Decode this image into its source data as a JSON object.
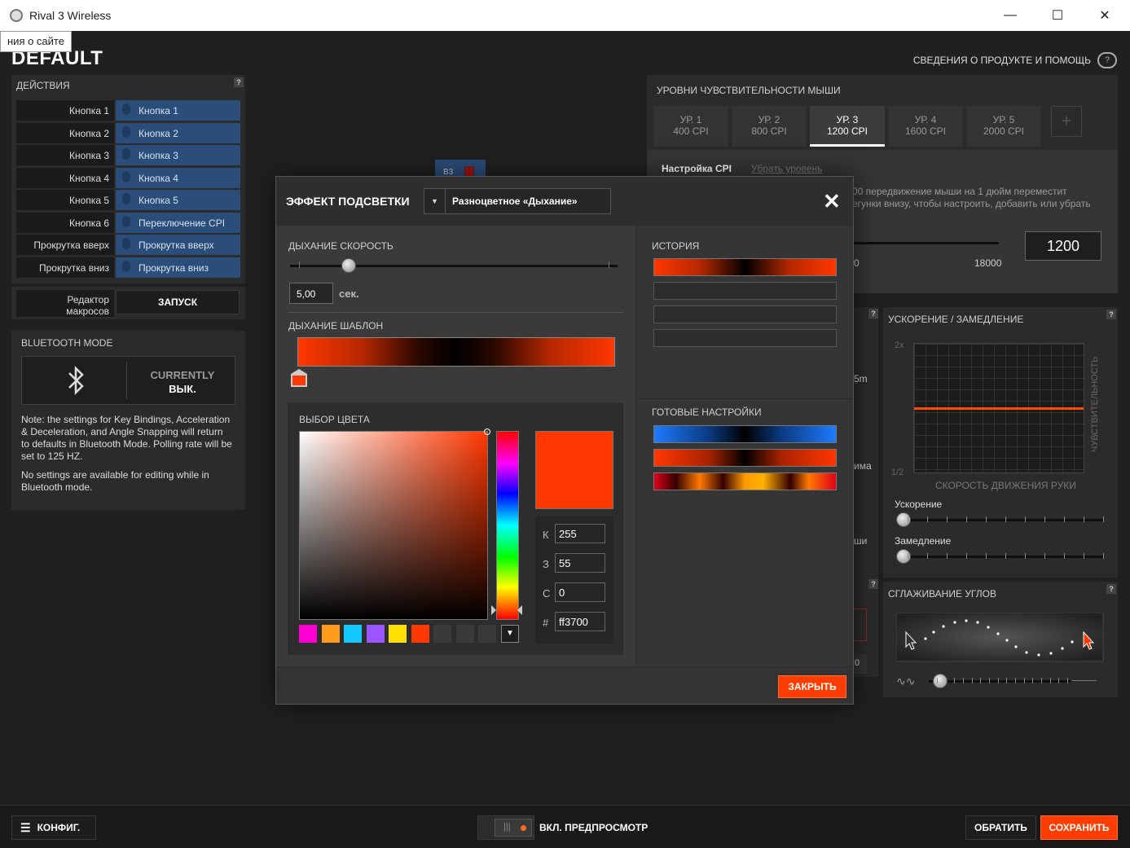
{
  "window": {
    "title": "Rival 3 Wireless",
    "minimize": "—",
    "maximize": "☐",
    "close": "✕"
  },
  "header": {
    "title": "DEFAULT",
    "tooltip": "ния о сайте",
    "help_link": "СВЕДЕНИЯ О ПРОДУКТЕ И ПОМОЩЬ",
    "help_icon": "?"
  },
  "actions": {
    "title": "ДЕЙСТВИЯ",
    "help": "?",
    "rows": [
      {
        "label": "Кнопка 1",
        "value": "Кнопка 1"
      },
      {
        "label": "Кнопка 2",
        "value": "Кнопка 2"
      },
      {
        "label": "Кнопка 3",
        "value": "Кнопка 3"
      },
      {
        "label": "Кнопка 4",
        "value": "Кнопка 4"
      },
      {
        "label": "Кнопка 5",
        "value": "Кнопка 5"
      },
      {
        "label": "Кнопка 6",
        "value": "Переключение CPI"
      },
      {
        "label": "Прокрутка вверх",
        "value": "Прокрутка вверх"
      },
      {
        "label": "Прокрутка вниз",
        "value": "Прокрутка вниз"
      }
    ]
  },
  "macro": {
    "label_line1": "Редактор",
    "label_line2": "макросов",
    "button": "ЗАПУСК"
  },
  "bluetooth": {
    "title": "BLUETOOTH MODE",
    "status_line1": "CURRENTLY",
    "status_line2": "ВЫК.",
    "note1": "Note: the settings for Key Bindings, Acceleration & Deceleration, and Angle Snapping will return to defaults in Bluetooth Mode. Polling rate will be set to 125 HZ.",
    "note2": "No settings are available for editing while in Bluetooth mode."
  },
  "cpi": {
    "title": "УРОВНИ ЧУВСТВИТЕЛЬНОСТИ МЫШИ",
    "tabs": [
      {
        "level": "УР. 1",
        "cpi": "400 CPI"
      },
      {
        "level": "УР. 2",
        "cpi": "800 CPI"
      },
      {
        "level": "УР. 3",
        "cpi": "1200 CPI"
      },
      {
        "level": "УР. 4",
        "cpi": "1600 CPI"
      },
      {
        "level": "УР. 5",
        "cpi": "2000 CPI"
      }
    ],
    "add": "+",
    "settings_tab": "Настройка CPI",
    "remove_level": "Убрать уровень",
    "desc_line1": "00 передвижение мыши на 1 дюйм переместит",
    "desc_line2": "егунки внизу, чтобы настроить, добавить или убрать",
    "min_label": "0",
    "max_label": "18000",
    "value": "1200"
  },
  "partial": {
    "b3": "B3",
    "m": "5m",
    "ma": "има",
    "shi": "ши",
    "zero": "0",
    "help": "?"
  },
  "acceleration": {
    "title": "УСКОРЕНИЕ / ЗАМЕДЛЕНИЕ",
    "help": "?",
    "y_top": "2x",
    "y_bottom": "1/2",
    "x_label": "СКОРОСТЬ ДВИЖЕНИЯ РУКИ",
    "y_label": "ЧУВСТВИТЕЛЬНОСТЬ",
    "accel_label": "Ускорение",
    "decel_label": "Замедление",
    "accel_value": 0,
    "decel_value": 0
  },
  "angle": {
    "title": "СГЛАЖИВАНИЕ УГЛОВ",
    "help": "?",
    "value": 0.08
  },
  "bottom": {
    "config": "КОНФИГ.",
    "preview": "ВКЛ. ПРЕДПРОСМОТР",
    "revert": "ОБРАТИТЬ",
    "save": "СОХРАНИТЬ"
  },
  "modal": {
    "title": "ЭФФЕКТ ПОДСВЕТКИ",
    "effect": "Разноцветное «Дыхание»",
    "close_icon": "✕",
    "speed_label": "ДЫХАНИЕ СКОРОСТЬ",
    "speed_value": "5,00",
    "speed_unit": "сек.",
    "speed_fraction": 0.18,
    "template_label": "ДЫХАНИЕ ШАБЛОН",
    "picker_label": "ВЫБОР ЦВЕТА",
    "rgb": {
      "r_label": "К",
      "r": "255",
      "g_label": "З",
      "g": "55",
      "b_label": "С",
      "b": "0",
      "hex_label": "#",
      "hex": "ff3700"
    },
    "accent": "#ff3700",
    "swatches": [
      "#ff00d4",
      "#ff9a1a",
      "#12c8ff",
      "#9a55ff",
      "#ffe000",
      "#ff3700",
      "#3a3a3a",
      "#3a3a3a",
      "#3a3a3a"
    ],
    "history_label": "ИСТОРИЯ",
    "presets_label": "ГОТОВЫЕ НАСТРОЙКИ",
    "close_button": "ЗАКРЫТЬ"
  }
}
